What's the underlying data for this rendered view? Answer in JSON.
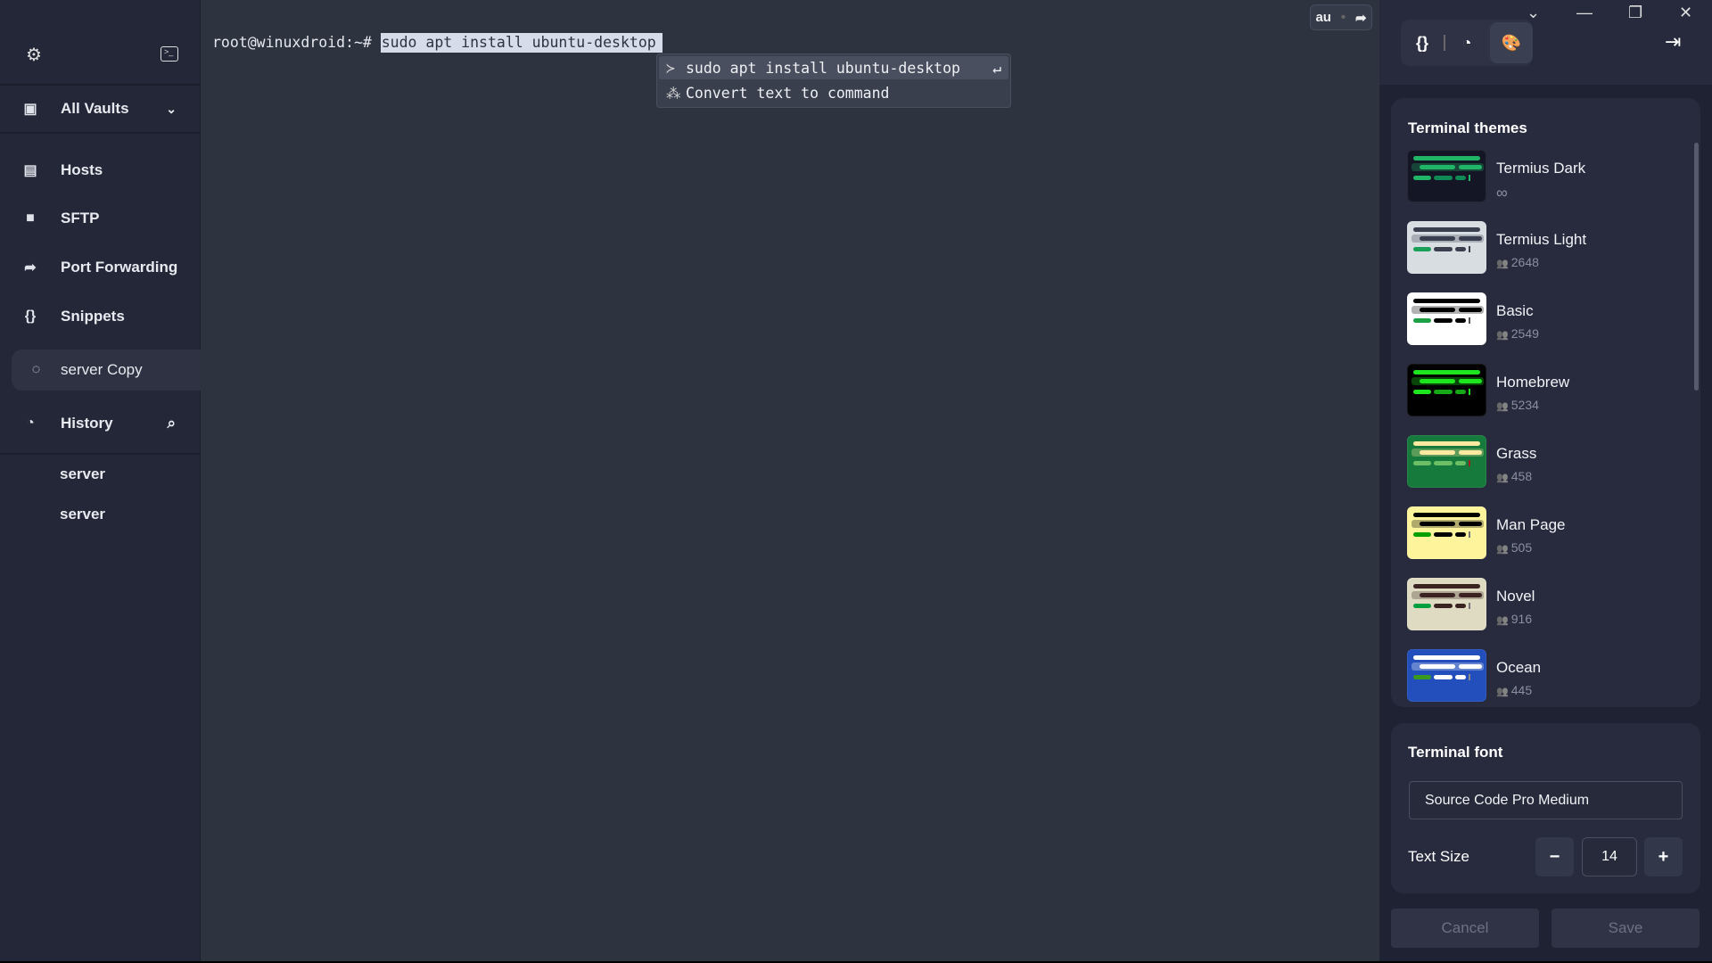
{
  "sidebar": {
    "vault": "All Vaults",
    "items": [
      {
        "label": "Hosts",
        "icon": "hosts-icon"
      },
      {
        "label": "SFTP",
        "icon": "folder-icon"
      },
      {
        "label": "Port Forwarding",
        "icon": "port-forward-icon"
      },
      {
        "label": "Snippets",
        "icon": "braces-icon"
      }
    ],
    "active_session": "server Copy",
    "history_label": "History",
    "history": [
      "server",
      "server"
    ]
  },
  "terminal": {
    "prompt": "root@winuxdroid:~# ",
    "command": "sudo apt install ubuntu-desktop",
    "suggestions": [
      "sudo apt install ubuntu-desktop",
      "Convert text to command"
    ],
    "autocomplete_text": "au"
  },
  "panel": {
    "themes_title": "Terminal themes",
    "themes": [
      {
        "name": "Termius Dark",
        "count": "∞",
        "bg": "#141625",
        "fg": "#21b568",
        "dim": "#0f8a55",
        "green": "#21b568",
        "cur": "#21b568"
      },
      {
        "name": "Termius Light",
        "count": "2648",
        "bg": "#d8dde2",
        "fg": "#3a3f50",
        "dim": "#3a3f50",
        "green": "#1ba05a",
        "cur": "#3a3f50"
      },
      {
        "name": "Basic",
        "count": "2549",
        "bg": "#ffffff",
        "fg": "#000000",
        "dim": "#000000",
        "green": "#1ea046",
        "cur": "#555555"
      },
      {
        "name": "Homebrew",
        "count": "5234",
        "bg": "#000000",
        "fg": "#1ee61e",
        "dim": "#17a817",
        "green": "#1ee61e",
        "cur": "#1ee61e"
      },
      {
        "name": "Grass",
        "count": "458",
        "bg": "#167a3c",
        "fg": "#fde9a0",
        "dim": "#6cbf64",
        "green": "#6cbf64",
        "cur": "#a02020"
      },
      {
        "name": "Man Page",
        "count": "505",
        "bg": "#fef49c",
        "fg": "#000000",
        "dim": "#000000",
        "green": "#00a000",
        "cur": "#777777"
      },
      {
        "name": "Novel",
        "count": "916",
        "bg": "#dfdbc3",
        "fg": "#3b2322",
        "dim": "#3b2322",
        "green": "#00a040",
        "cur": "#777777"
      },
      {
        "name": "Ocean",
        "count": "445",
        "bg": "#224fbc",
        "fg": "#ffffff",
        "dim": "#ffffff",
        "green": "#3a9a20",
        "cur": "#888888"
      }
    ],
    "font_title": "Terminal font",
    "font_value": "Source Code Pro Medium",
    "text_size_label": "Text Size",
    "text_size": "14",
    "minus": "−",
    "plus": "+",
    "cancel": "Cancel",
    "save": "Save"
  }
}
